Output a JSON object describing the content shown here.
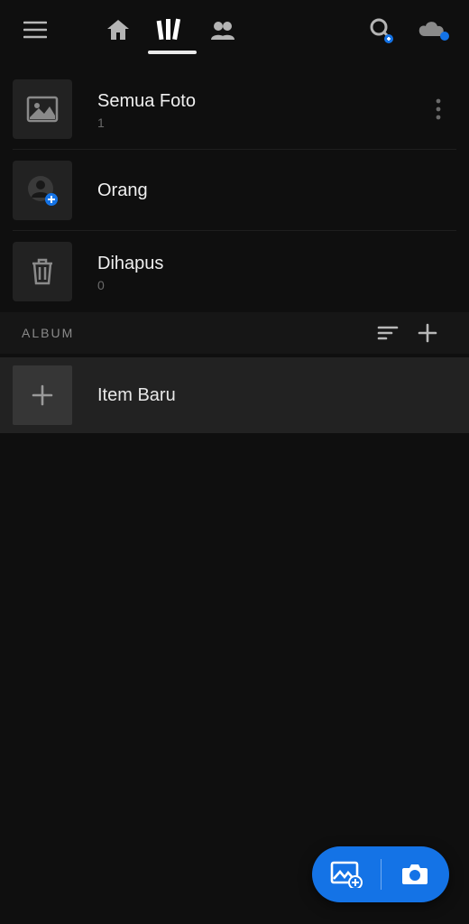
{
  "library": {
    "items": [
      {
        "title": "Semua Foto",
        "count": "1",
        "icon": "photos"
      },
      {
        "title": "Orang",
        "count": "",
        "icon": "people"
      },
      {
        "title": "Dihapus",
        "count": "0",
        "icon": "trash"
      }
    ]
  },
  "album_section": {
    "label": "ALBUM"
  },
  "albums": [
    {
      "title": "Item Baru"
    }
  ]
}
